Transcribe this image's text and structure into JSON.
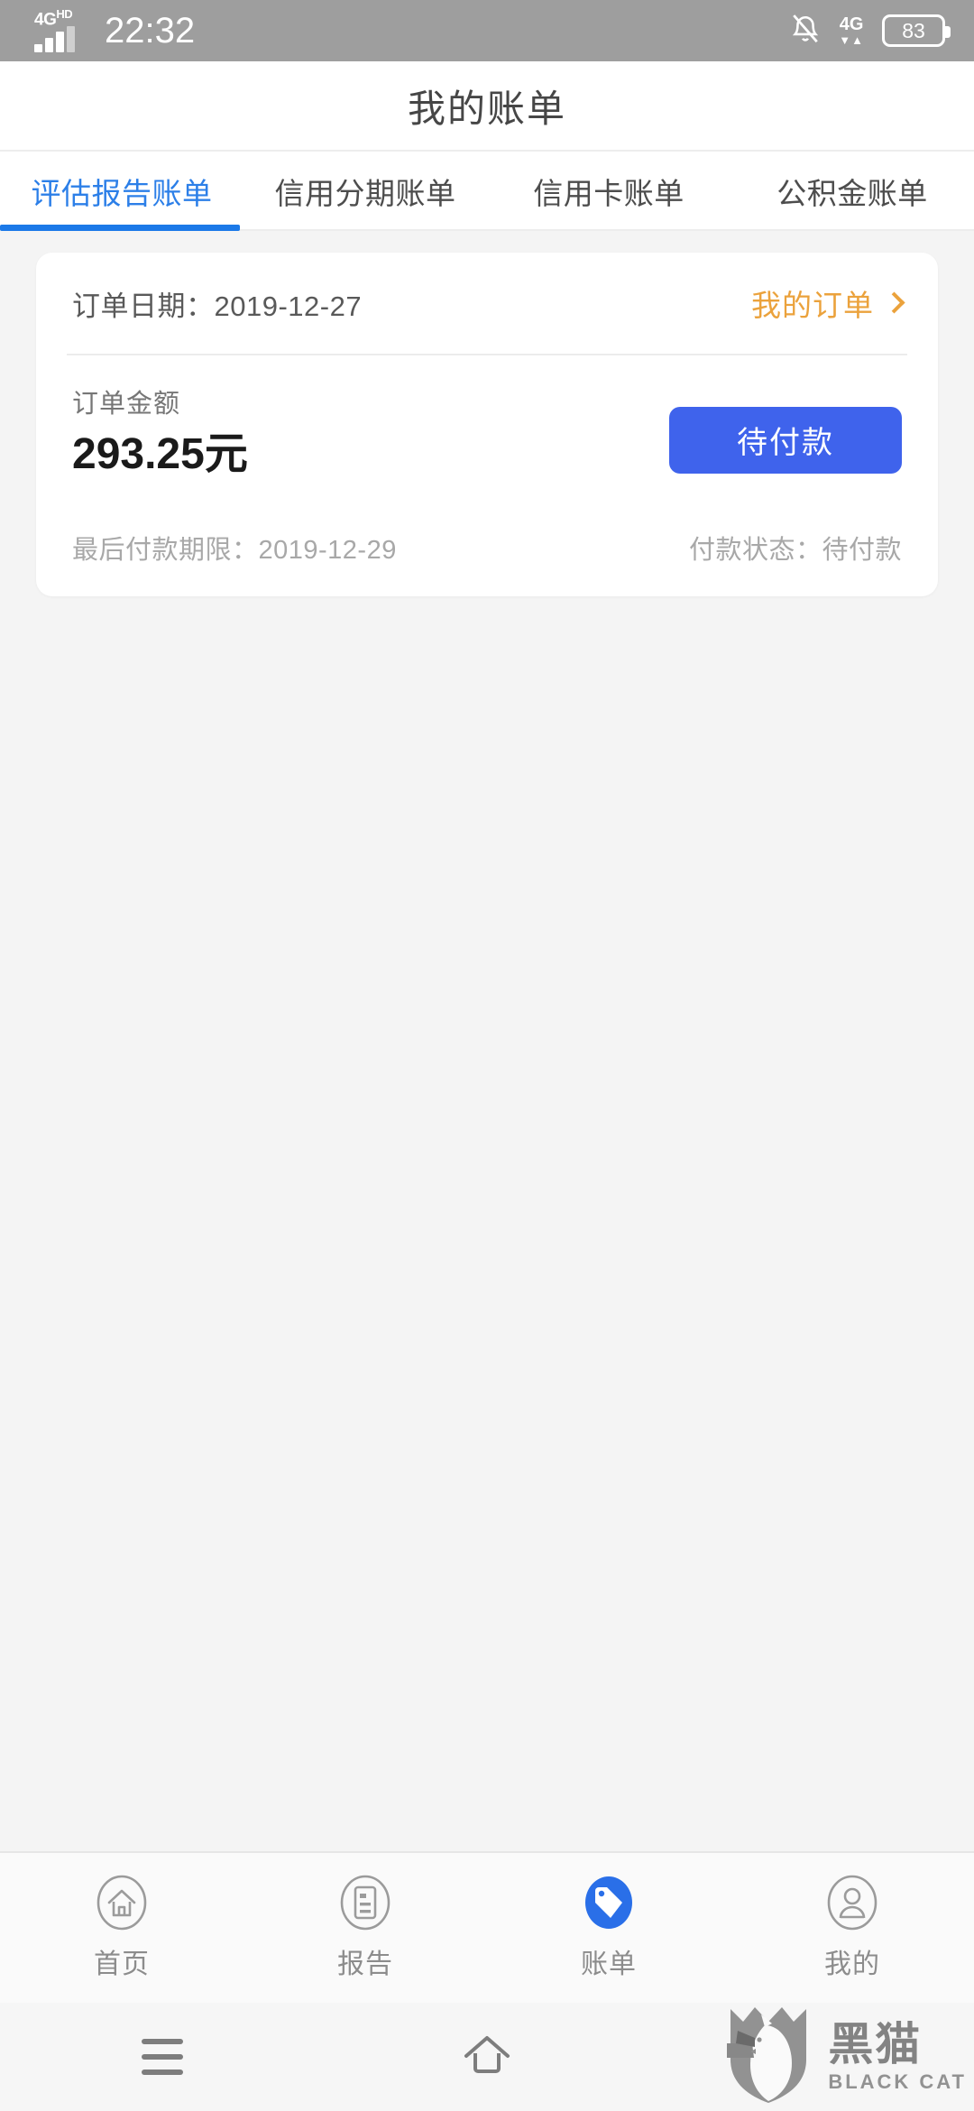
{
  "status_bar": {
    "network_label": "4G",
    "network_sup": "HD",
    "time": "22:32",
    "mute_icon": "bell-muted-icon",
    "data_network": "4G",
    "data_arrows": "▼▲",
    "battery_level": "83"
  },
  "header": {
    "title": "我的账单"
  },
  "tabs": [
    {
      "label": "评估报告账单",
      "active": true
    },
    {
      "label": "信用分期账单",
      "active": false
    },
    {
      "label": "信用卡账单",
      "active": false
    },
    {
      "label": "公积金账单",
      "active": false
    }
  ],
  "bill_card": {
    "order_date_label": "订单日期：",
    "order_date_value": "2019-12-27",
    "order_date_full": "订单日期：2019-12-27",
    "my_orders_label": "我的订单",
    "chevron_icon": "chevron-right-icon",
    "amount_label": "订单金额",
    "amount_value": "293.25元",
    "pay_button_label": "待付款",
    "deadline_text": "最后付款期限：2019-12-29",
    "status_text": "付款状态：待付款"
  },
  "bottom_nav": [
    {
      "label": "首页",
      "icon": "home-icon",
      "active": false
    },
    {
      "label": "报告",
      "icon": "document-icon",
      "active": false
    },
    {
      "label": "账单",
      "icon": "price-tag-icon",
      "active": true
    },
    {
      "label": "我的",
      "icon": "person-icon",
      "active": false
    }
  ],
  "android_nav": {
    "menu_icon": "menu-icon",
    "home_icon": "home-outline-icon"
  },
  "watermark": {
    "cn": "黑猫",
    "en": "BLACK CAT",
    "shield_icon": "black-cat-shield-logo"
  },
  "colors": {
    "accent_blue": "#1b79e8",
    "button_blue": "#3f63ec",
    "link_orange": "#eba23c",
    "status_bar_gray": "#9e9e9e",
    "page_bg": "#f4f4f4"
  }
}
